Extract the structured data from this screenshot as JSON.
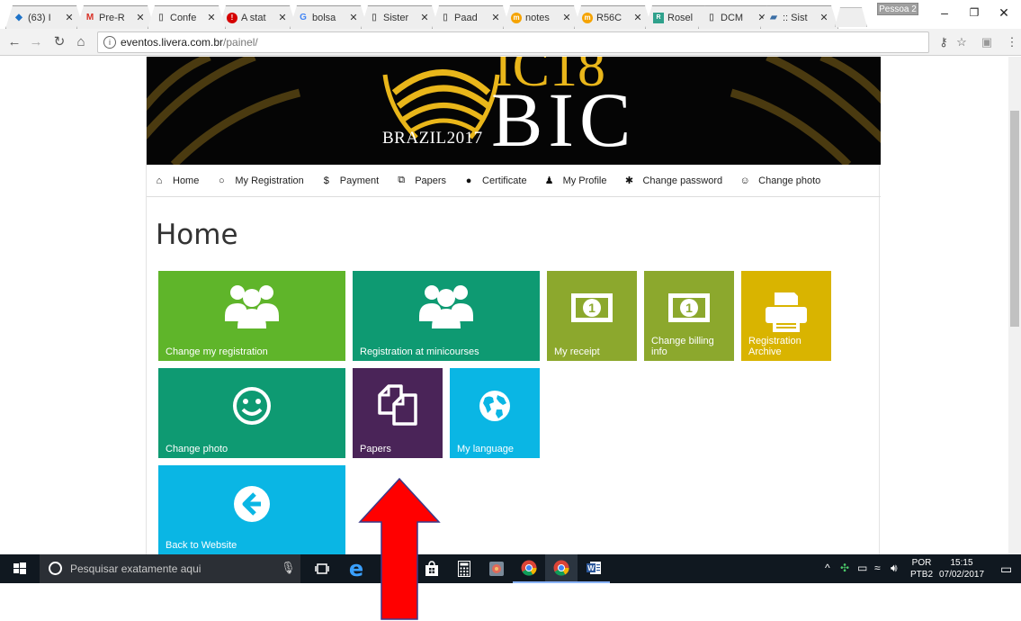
{
  "browser": {
    "tabs": [
      {
        "title": "(63) I",
        "icon": "chat-icon",
        "active": false
      },
      {
        "title": "Pre-R",
        "icon": "gmail-icon",
        "active": false
      },
      {
        "title": "Confe",
        "icon": "page-icon",
        "active": true
      },
      {
        "title": "A stat",
        "icon": "red-circle-icon",
        "active": false
      },
      {
        "title": "bolsa",
        "icon": "google-icon",
        "active": false
      },
      {
        "title": "Sister",
        "icon": "page-icon",
        "active": false
      },
      {
        "title": "Paad",
        "icon": "page-icon",
        "active": false
      },
      {
        "title": "notes",
        "icon": "mooc-icon",
        "active": false
      },
      {
        "title": "R56C",
        "icon": "mooc-icon",
        "active": false
      },
      {
        "title": "Rosel",
        "icon": "rg-icon",
        "active": false
      },
      {
        "title": "DCM",
        "icon": "page-icon",
        "active": false
      },
      {
        "title": ":: Sist",
        "icon": "folder-icon",
        "active": false
      }
    ],
    "profile_label": "Pessoa 2",
    "url_host": "eventos.livera.com.br",
    "url_path": "/painel/"
  },
  "site": {
    "banner": {
      "logo_top": "IC18",
      "logo_main": "BIC",
      "logo_sub": "BRAZIL2017",
      "gold": "#e9b61a"
    },
    "nav": [
      {
        "label": "Home",
        "icon": "home-icon",
        "glyph": "⌂"
      },
      {
        "label": "My Registration",
        "icon": "circle-icon",
        "glyph": "○"
      },
      {
        "label": "Payment",
        "icon": "dollar-icon",
        "glyph": "$"
      },
      {
        "label": "Papers",
        "icon": "copy-icon",
        "glyph": "⧉"
      },
      {
        "label": "Certificate",
        "icon": "certificate-icon",
        "glyph": "●"
      },
      {
        "label": "My Profile",
        "icon": "user-icon",
        "glyph": "♟"
      },
      {
        "label": "Change password",
        "icon": "asterisk-icon",
        "glyph": "✱"
      },
      {
        "label": "Change photo",
        "icon": "smile-icon",
        "glyph": "☺"
      }
    ],
    "page_title": "Home",
    "tiles": [
      {
        "label": "Change my registration",
        "icon": "users-icon",
        "color": "#5fb52a"
      },
      {
        "label": "Registration at minicourses",
        "icon": "users-icon",
        "color": "#0e9a72"
      },
      {
        "label": "My receipt",
        "icon": "money-icon",
        "color": "#8ca82d"
      },
      {
        "label": "Change billing info",
        "icon": "money-icon",
        "color": "#8ca82d"
      },
      {
        "label": "Registration Archive",
        "icon": "printer-icon",
        "color": "#d9b400"
      },
      {
        "label": "Change photo",
        "icon": "smile-icon",
        "color": "#0e9a72"
      },
      {
        "label": "Papers",
        "icon": "copy-icon",
        "color": "#4a2458"
      },
      {
        "label": "My language",
        "icon": "globe-icon",
        "color": "#0ab6e4"
      },
      {
        "label": "Back to Website",
        "icon": "arrow-left-circle-icon",
        "color": "#0ab6e4"
      }
    ]
  },
  "taskbar": {
    "search_placeholder": "Pesquisar exatamente aqui",
    "lang_top": "POR",
    "lang_bottom": "PTB2",
    "time": "15:15",
    "date": "07/02/2017"
  },
  "annotation": {
    "arrow_color": "#ff0000",
    "arrow_target": "Papers"
  }
}
